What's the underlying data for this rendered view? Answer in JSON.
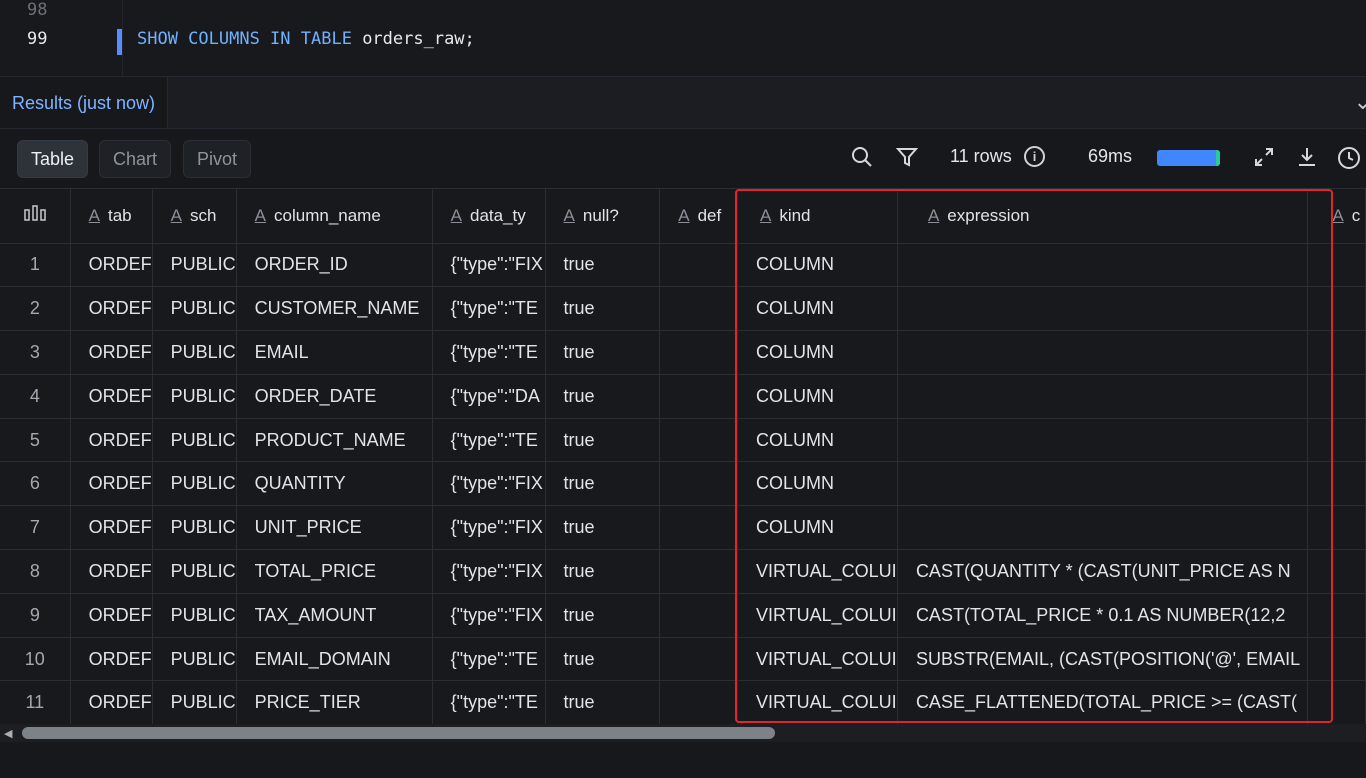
{
  "editor": {
    "line_numbers": [
      "98",
      "99"
    ],
    "code": {
      "kw1": "SHOW COLUMNS IN TABLE",
      "ident": "orders_raw;"
    }
  },
  "results": {
    "tab_label": "Results (just now)"
  },
  "toolbar": {
    "views": [
      "Table",
      "Chart",
      "Pivot"
    ],
    "active_view": "Table",
    "row_count": "11 rows",
    "duration": "69ms",
    "progress_fraction": 1.0
  },
  "grid": {
    "columns": [
      "tab",
      "sch",
      "column_name",
      "data_ty",
      "null?",
      "def",
      "kind",
      "expression",
      "c"
    ],
    "rows": [
      [
        "1",
        "ORDEF",
        "PUBLIC",
        "ORDER_ID",
        "{\"type\":\"FIX",
        "true",
        "",
        "COLUMN",
        ""
      ],
      [
        "2",
        "ORDEF",
        "PUBLIC",
        "CUSTOMER_NAME",
        "{\"type\":\"TE",
        "true",
        "",
        "COLUMN",
        ""
      ],
      [
        "3",
        "ORDEF",
        "PUBLIC",
        "EMAIL",
        "{\"type\":\"TE",
        "true",
        "",
        "COLUMN",
        ""
      ],
      [
        "4",
        "ORDEF",
        "PUBLIC",
        "ORDER_DATE",
        "{\"type\":\"DA",
        "true",
        "",
        "COLUMN",
        ""
      ],
      [
        "5",
        "ORDEF",
        "PUBLIC",
        "PRODUCT_NAME",
        "{\"type\":\"TE",
        "true",
        "",
        "COLUMN",
        ""
      ],
      [
        "6",
        "ORDEF",
        "PUBLIC",
        "QUANTITY",
        "{\"type\":\"FIX",
        "true",
        "",
        "COLUMN",
        ""
      ],
      [
        "7",
        "ORDEF",
        "PUBLIC",
        "UNIT_PRICE",
        "{\"type\":\"FIX",
        "true",
        "",
        "COLUMN",
        ""
      ],
      [
        "8",
        "ORDEF",
        "PUBLIC",
        "TOTAL_PRICE",
        "{\"type\":\"FIX",
        "true",
        "",
        "VIRTUAL_COLUI",
        "CAST(QUANTITY * (CAST(UNIT_PRICE AS N"
      ],
      [
        "9",
        "ORDEF",
        "PUBLIC",
        "TAX_AMOUNT",
        "{\"type\":\"FIX",
        "true",
        "",
        "VIRTUAL_COLUI",
        "CAST(TOTAL_PRICE * 0.1 AS NUMBER(12,2"
      ],
      [
        "10",
        "ORDEF",
        "PUBLIC",
        "EMAIL_DOMAIN",
        "{\"type\":\"TE",
        "true",
        "",
        "VIRTUAL_COLUI",
        "SUBSTR(EMAIL, (CAST(POSITION('@', EMAIL"
      ],
      [
        "11",
        "ORDEF",
        "PUBLIC",
        "PRICE_TIER",
        "{\"type\":\"TE",
        "true",
        "",
        "VIRTUAL_COLUI",
        "CASE_FLATTENED(TOTAL_PRICE >= (CAST("
      ]
    ]
  },
  "colors": {
    "accent": "#3f86ff",
    "highlight": "#e0252d",
    "keyword": "#6fb0ff"
  }
}
